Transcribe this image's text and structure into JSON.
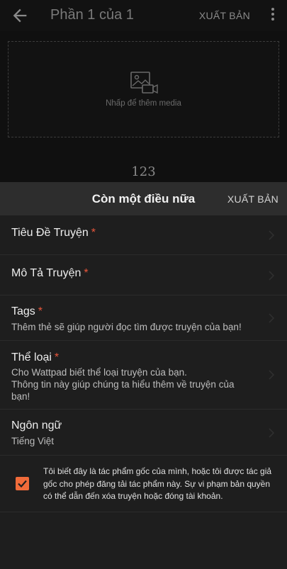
{
  "topbar": {
    "title": "Phần 1 của 1",
    "publish_label": "XUẤT BẢN"
  },
  "media": {
    "hint": "Nhấp để thêm media"
  },
  "story_number": "123",
  "sheet": {
    "title": "Còn một điều nữa",
    "publish_label": "XUẤT BẢN",
    "fields": [
      {
        "label": "Tiêu Đề Truyện",
        "required_mark": "*",
        "subtext": ""
      },
      {
        "label": "Mô Tả Truyện",
        "required_mark": "*",
        "subtext": ""
      },
      {
        "label": "Tags",
        "required_mark": "*",
        "subtext": "Thêm thẻ sẽ giúp người đọc tìm được truyện của bạn!"
      },
      {
        "label": "Thể loại",
        "required_mark": "*",
        "subtext": "Cho Wattpad biết thể loại truyện của bạn.\nThông tin này giúp chúng ta hiểu thêm về truyện của bạn!"
      },
      {
        "label": "Ngôn ngữ",
        "required_mark": "",
        "subtext": "Tiếng Việt"
      }
    ],
    "terms": {
      "checked": true,
      "text": "Tôi biết đây là tác phẩm gốc của mình, hoặc tôi được tác giả gốc cho phép đăng tải tác phẩm này. Sự vi phạm bản quyền có thể dẫn đến xóa truyện hoặc đóng tài khoản."
    }
  },
  "colors": {
    "accent": "#f06b3a",
    "required": "#e8563b"
  }
}
